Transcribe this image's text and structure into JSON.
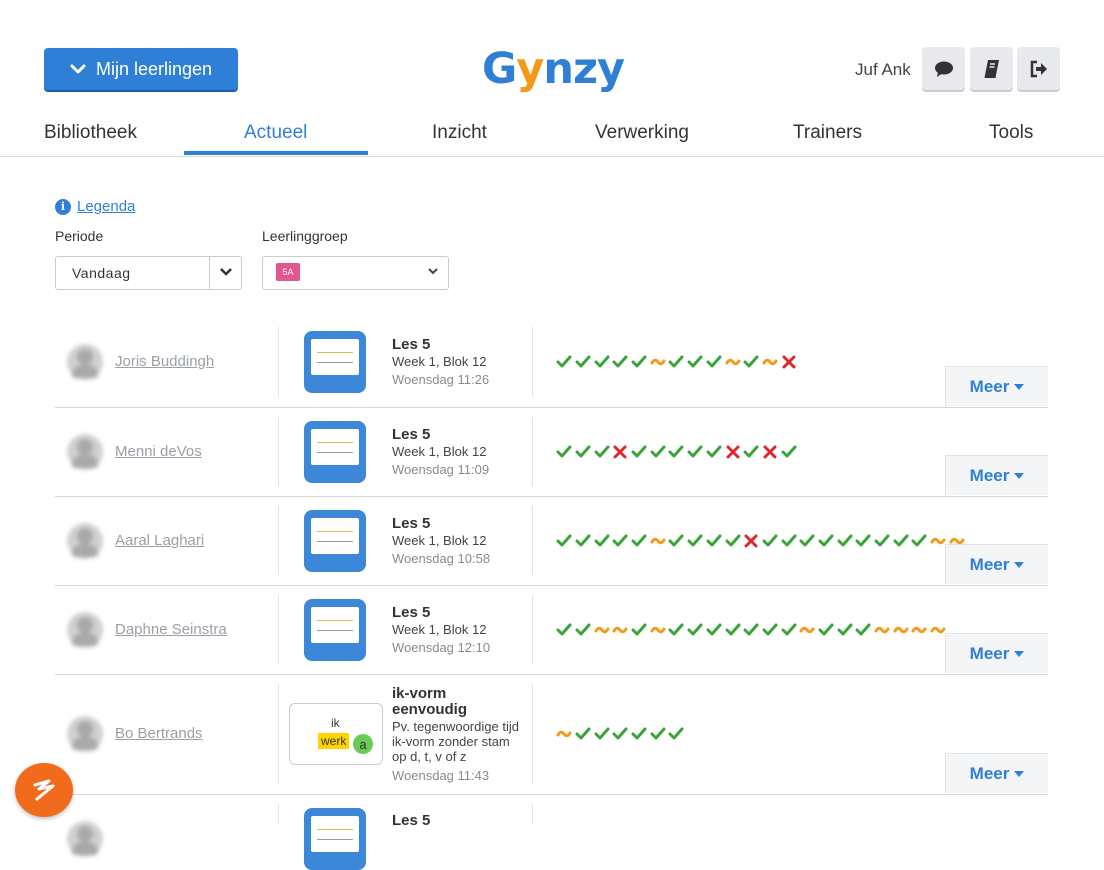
{
  "header": {
    "students_button": "Mijn leerlingen",
    "logo": "Gynzy",
    "user_name": "Juf Ank",
    "icons": [
      "chat-icon",
      "book-icon",
      "logout-icon"
    ]
  },
  "nav": {
    "tabs": [
      "Bibliotheek",
      "Actueel",
      "Inzicht",
      "Verwerking",
      "Trainers",
      "Tools"
    ],
    "active": "Actueel"
  },
  "filters": {
    "legend_link": "Legenda",
    "period_label": "Periode",
    "period_value": "Vandaag",
    "group_label": "Leerlinggroep",
    "group_value": "5A"
  },
  "rows": [
    {
      "student": "Joris Buddingh",
      "lesson_title": "Les 5",
      "lesson_sub": "Week 1, Blok 12",
      "time": "Woensdag 11:26",
      "results": "vvvvv~vvv~v~x",
      "meer": "Meer"
    },
    {
      "student": "Menni deVos",
      "lesson_title": "Les 5",
      "lesson_sub": "Week 1, Blok 12",
      "time": "Woensdag 11:09",
      "results": "vvvxvvvvvxvxv",
      "meer": "Meer"
    },
    {
      "student": "Aaral Laghari",
      "lesson_title": "Les 5",
      "lesson_sub": "Week 1, Blok 12",
      "time": "Woensdag 10:58",
      "results": "vvvvv~vvvvxvvvvvvvvv~~",
      "meer": "Meer"
    },
    {
      "student": "Daphne Seinstra",
      "lesson_title": "Les 5",
      "lesson_sub": "Week 1, Blok 12",
      "time": "Woensdag 12:10",
      "results": "vv~~v~vvvvvvv~vvv~~~~",
      "meer": "Meer"
    },
    {
      "student": "Bo Bertrands",
      "lesson_title": "ik-vorm eenvoudig",
      "lesson_sub": "Pv. tegenwoordige tijd ik-vorm zonder stam op d, t, v of z",
      "time": "Woensdag 11:43",
      "results": "~vvvvvv",
      "meer": "Meer",
      "thumb_ik": "ik",
      "thumb_werk": "werk",
      "thumb_a": "a"
    },
    {
      "student": "",
      "lesson_title": "Les 5",
      "lesson_sub": "",
      "time": "",
      "results": "",
      "meer": ""
    }
  ],
  "colors": {
    "primary": "#2f7fd6",
    "check": "#3aa33a",
    "cross": "#e0262a",
    "partial": "#f39a1b"
  }
}
